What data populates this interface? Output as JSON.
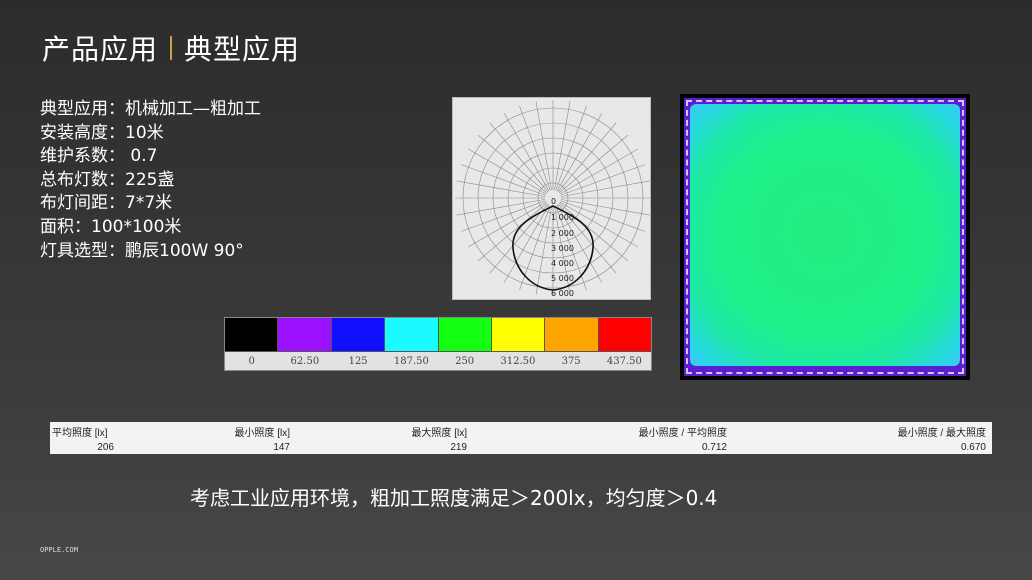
{
  "header": {
    "section": "产品应用",
    "subtitle": "典型应用"
  },
  "specs": [
    "典型应用：机械加工—粗加工",
    "安装高度：10米",
    "维护系数：  0.7",
    "总布灯数：225盏",
    "布灯间距：7*7米",
    "面积：100*100米",
    "灯具选型：鹏辰100W 90°"
  ],
  "polar": {
    "labels": [
      "0",
      "1 000",
      "2 000",
      "3 000",
      "4 000",
      "5 000",
      "6 000"
    ]
  },
  "scale": {
    "colors": [
      "#000000",
      "#9b10ff",
      "#1010ff",
      "#19fbff",
      "#12ff12",
      "#ffff00",
      "#ffa500",
      "#ff0000"
    ],
    "labels": [
      "0",
      "62.50",
      "125",
      "187.50",
      "250",
      "312.50",
      "375",
      "437.50"
    ]
  },
  "stats": {
    "headers": [
      "平均照度 [lx]",
      "最小照度 [lx]",
      "最大照度 [lx]",
      "最小照度 / 平均照度",
      "最小照度 / 最大照度"
    ],
    "values": [
      "206",
      "147",
      "219",
      "0.712",
      "0.670"
    ]
  },
  "conclusion": "考虑工业应用环境，粗加工照度满足＞200lx，均匀度＞0.4",
  "footer": "OPPLE.COM"
}
